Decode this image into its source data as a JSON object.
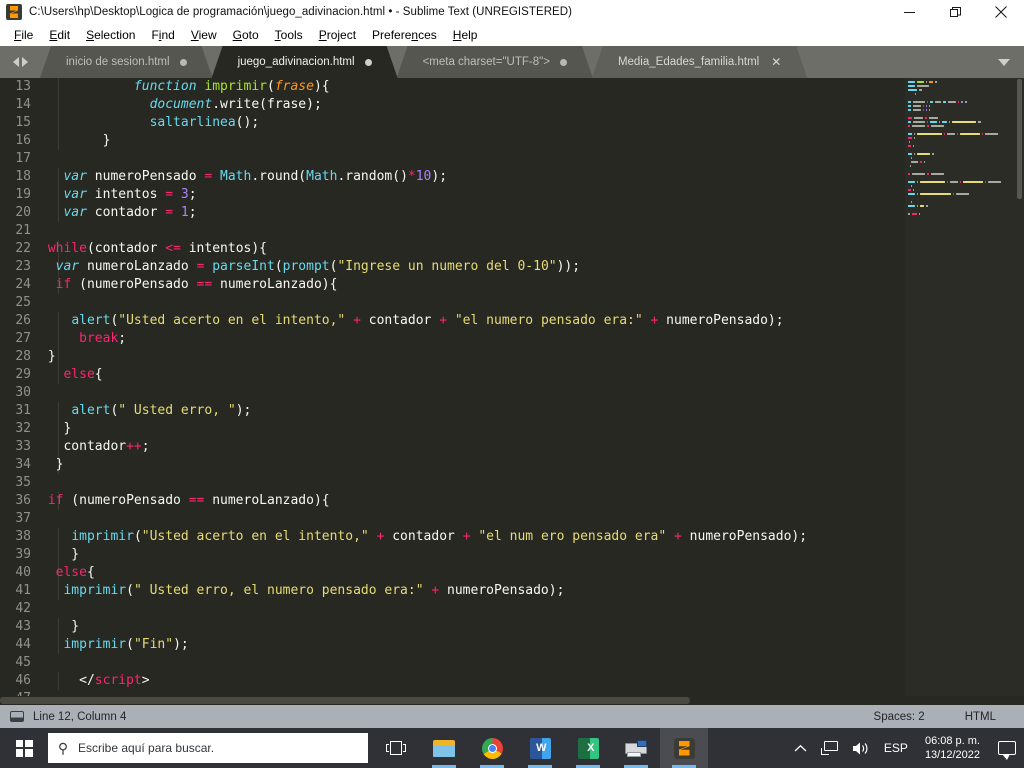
{
  "window": {
    "title": "C:\\Users\\hp\\Desktop\\Logica de programación\\juego_adivinacion.html • - Sublime Text (UNREGISTERED)",
    "app_icon": "sublime-text-icon",
    "controls": {
      "minimize": "minimize-icon",
      "maximize": "maximize-icon",
      "close": "close-icon"
    }
  },
  "menubar": {
    "items": [
      {
        "label": "File",
        "mnemonic": "F"
      },
      {
        "label": "Edit",
        "mnemonic": "E"
      },
      {
        "label": "Selection",
        "mnemonic": "S"
      },
      {
        "label": "Find",
        "mnemonic": "i"
      },
      {
        "label": "View",
        "mnemonic": "V"
      },
      {
        "label": "Goto",
        "mnemonic": "G"
      },
      {
        "label": "Tools",
        "mnemonic": "T"
      },
      {
        "label": "Project",
        "mnemonic": "P"
      },
      {
        "label": "Preferences",
        "mnemonic": "n"
      },
      {
        "label": "Help",
        "mnemonic": "H"
      }
    ]
  },
  "tabbar": {
    "nav_back_icon": "arrow-left-icon",
    "nav_forward_icon": "arrow-right-icon",
    "overflow_icon": "chevron-down-icon",
    "tabs": [
      {
        "label": "inicio de sesion.html",
        "state": "inactive",
        "dirty": true,
        "close": false
      },
      {
        "label": "juego_adivinacion.html",
        "state": "active",
        "dirty": true,
        "close": false
      },
      {
        "label": "<meta charset=\"UTF-8\">",
        "state": "inactive",
        "dirty": true,
        "close": false
      },
      {
        "label": "Media_Edades_familia.html",
        "state": "hover",
        "dirty": false,
        "close": true
      }
    ]
  },
  "editor": {
    "first_line": 13,
    "lines": [
      {
        "num": 13,
        "tokens": [
          {
            "t": "            ",
            "c": "p"
          },
          {
            "t": "function",
            "c": "it"
          },
          {
            "t": " ",
            "c": "p"
          },
          {
            "t": "imprimir",
            "c": "fn"
          },
          {
            "t": "(",
            "c": "p"
          },
          {
            "t": "frase",
            "c": "pa"
          },
          {
            "t": "){",
            "c": "p"
          }
        ]
      },
      {
        "num": 14,
        "tokens": [
          {
            "t": "              ",
            "c": "p"
          },
          {
            "t": "document",
            "c": "it"
          },
          {
            "t": ".write(frase);",
            "c": "p"
          }
        ]
      },
      {
        "num": 15,
        "tokens": [
          {
            "t": "              ",
            "c": "p"
          },
          {
            "t": "saltarlinea",
            "c": "f"
          },
          {
            "t": "();",
            "c": "p"
          }
        ]
      },
      {
        "num": 16,
        "tokens": [
          {
            "t": "        }",
            "c": "p"
          }
        ]
      },
      {
        "num": 17,
        "tokens": []
      },
      {
        "num": 18,
        "tokens": [
          {
            "t": "   ",
            "c": "p"
          },
          {
            "t": "var",
            "c": "it"
          },
          {
            "t": " numeroPensado ",
            "c": "p"
          },
          {
            "t": "=",
            "c": "k"
          },
          {
            "t": " ",
            "c": "p"
          },
          {
            "t": "Math",
            "c": "f"
          },
          {
            "t": ".round(",
            "c": "p"
          },
          {
            "t": "Math",
            "c": "f"
          },
          {
            "t": ".random()",
            "c": "p"
          },
          {
            "t": "*",
            "c": "k"
          },
          {
            "t": "10",
            "c": "n"
          },
          {
            "t": ");",
            "c": "p"
          }
        ]
      },
      {
        "num": 19,
        "tokens": [
          {
            "t": "   ",
            "c": "p"
          },
          {
            "t": "var",
            "c": "it"
          },
          {
            "t": " intentos ",
            "c": "p"
          },
          {
            "t": "=",
            "c": "k"
          },
          {
            "t": " ",
            "c": "p"
          },
          {
            "t": "3",
            "c": "n"
          },
          {
            "t": ";",
            "c": "p"
          }
        ]
      },
      {
        "num": 20,
        "tokens": [
          {
            "t": "   ",
            "c": "p"
          },
          {
            "t": "var",
            "c": "it"
          },
          {
            "t": " contador ",
            "c": "p"
          },
          {
            "t": "=",
            "c": "k"
          },
          {
            "t": " ",
            "c": "p"
          },
          {
            "t": "1",
            "c": "n"
          },
          {
            "t": ";",
            "c": "p"
          }
        ]
      },
      {
        "num": 21,
        "tokens": []
      },
      {
        "num": 22,
        "tokens": [
          {
            "t": " ",
            "c": "p"
          },
          {
            "t": "while",
            "c": "k"
          },
          {
            "t": "(contador ",
            "c": "p"
          },
          {
            "t": "<=",
            "c": "k"
          },
          {
            "t": " intentos){",
            "c": "p"
          }
        ]
      },
      {
        "num": 23,
        "tokens": [
          {
            "t": "  ",
            "c": "p"
          },
          {
            "t": "var",
            "c": "it"
          },
          {
            "t": " numeroLanzado ",
            "c": "p"
          },
          {
            "t": "=",
            "c": "k"
          },
          {
            "t": " ",
            "c": "p"
          },
          {
            "t": "parseInt",
            "c": "f"
          },
          {
            "t": "(",
            "c": "p"
          },
          {
            "t": "prompt",
            "c": "f"
          },
          {
            "t": "(",
            "c": "p"
          },
          {
            "t": "\"Ingrese un numero del 0-10\"",
            "c": "s"
          },
          {
            "t": "));",
            "c": "p"
          }
        ]
      },
      {
        "num": 24,
        "tokens": [
          {
            "t": "  ",
            "c": "p"
          },
          {
            "t": "if",
            "c": "k"
          },
          {
            "t": " (numeroPensado ",
            "c": "p"
          },
          {
            "t": "==",
            "c": "k"
          },
          {
            "t": " numeroLanzado){",
            "c": "p"
          }
        ]
      },
      {
        "num": 25,
        "tokens": []
      },
      {
        "num": 26,
        "tokens": [
          {
            "t": "    ",
            "c": "p"
          },
          {
            "t": "alert",
            "c": "f"
          },
          {
            "t": "(",
            "c": "p"
          },
          {
            "t": "\"Usted acerto en el intento,\"",
            "c": "s"
          },
          {
            "t": " ",
            "c": "p"
          },
          {
            "t": "+",
            "c": "k"
          },
          {
            "t": " contador ",
            "c": "p"
          },
          {
            "t": "+",
            "c": "k"
          },
          {
            "t": " ",
            "c": "p"
          },
          {
            "t": "\"el numero pensado era:\"",
            "c": "s"
          },
          {
            "t": " ",
            "c": "p"
          },
          {
            "t": "+",
            "c": "k"
          },
          {
            "t": " numeroPensado);",
            "c": "p"
          }
        ]
      },
      {
        "num": 27,
        "tokens": [
          {
            "t": "     ",
            "c": "p"
          },
          {
            "t": "break",
            "c": "k"
          },
          {
            "t": ";",
            "c": "p"
          }
        ]
      },
      {
        "num": 28,
        "tokens": [
          {
            "t": " }",
            "c": "p"
          }
        ]
      },
      {
        "num": 29,
        "tokens": [
          {
            "t": "   ",
            "c": "p"
          },
          {
            "t": "else",
            "c": "k"
          },
          {
            "t": "{",
            "c": "p"
          }
        ]
      },
      {
        "num": 30,
        "tokens": []
      },
      {
        "num": 31,
        "tokens": [
          {
            "t": "    ",
            "c": "p"
          },
          {
            "t": "alert",
            "c": "f"
          },
          {
            "t": "(",
            "c": "p"
          },
          {
            "t": "\" Usted erro, \"",
            "c": "s"
          },
          {
            "t": ");",
            "c": "p"
          }
        ]
      },
      {
        "num": 32,
        "tokens": [
          {
            "t": "   }",
            "c": "p"
          }
        ]
      },
      {
        "num": 33,
        "tokens": [
          {
            "t": "   contador",
            "c": "p"
          },
          {
            "t": "++",
            "c": "k"
          },
          {
            "t": ";",
            "c": "p"
          }
        ]
      },
      {
        "num": 34,
        "tokens": [
          {
            "t": "  }",
            "c": "p"
          }
        ]
      },
      {
        "num": 35,
        "tokens": []
      },
      {
        "num": 36,
        "tokens": [
          {
            "t": " ",
            "c": "p"
          },
          {
            "t": "if",
            "c": "k"
          },
          {
            "t": " (numeroPensado ",
            "c": "p"
          },
          {
            "t": "==",
            "c": "k"
          },
          {
            "t": " numeroLanzado){",
            "c": "p"
          }
        ]
      },
      {
        "num": 37,
        "tokens": []
      },
      {
        "num": 38,
        "tokens": [
          {
            "t": "    ",
            "c": "p"
          },
          {
            "t": "imprimir",
            "c": "f"
          },
          {
            "t": "(",
            "c": "p"
          },
          {
            "t": "\"Usted acerto en el intento,\"",
            "c": "s"
          },
          {
            "t": " ",
            "c": "p"
          },
          {
            "t": "+",
            "c": "k"
          },
          {
            "t": " contador ",
            "c": "p"
          },
          {
            "t": "+",
            "c": "k"
          },
          {
            "t": " ",
            "c": "p"
          },
          {
            "t": "\"el num ero pensado era\"",
            "c": "s"
          },
          {
            "t": " ",
            "c": "p"
          },
          {
            "t": "+",
            "c": "k"
          },
          {
            "t": " numeroPensado);",
            "c": "p"
          }
        ]
      },
      {
        "num": 39,
        "tokens": [
          {
            "t": "    }",
            "c": "p"
          }
        ]
      },
      {
        "num": 40,
        "tokens": [
          {
            "t": "  ",
            "c": "p"
          },
          {
            "t": "else",
            "c": "k"
          },
          {
            "t": "{",
            "c": "p"
          }
        ]
      },
      {
        "num": 41,
        "tokens": [
          {
            "t": "   ",
            "c": "p"
          },
          {
            "t": "imprimir",
            "c": "f"
          },
          {
            "t": "(",
            "c": "p"
          },
          {
            "t": "\" Usted erro, el numero pensado era:\"",
            "c": "s"
          },
          {
            "t": " ",
            "c": "p"
          },
          {
            "t": "+",
            "c": "k"
          },
          {
            "t": " numeroPensado);",
            "c": "p"
          }
        ]
      },
      {
        "num": 42,
        "tokens": []
      },
      {
        "num": 43,
        "tokens": [
          {
            "t": "    }",
            "c": "p"
          }
        ]
      },
      {
        "num": 44,
        "tokens": [
          {
            "t": "   ",
            "c": "p"
          },
          {
            "t": "imprimir",
            "c": "f"
          },
          {
            "t": "(",
            "c": "p"
          },
          {
            "t": "\"Fin\"",
            "c": "s"
          },
          {
            "t": ");",
            "c": "p"
          }
        ]
      },
      {
        "num": 45,
        "tokens": []
      },
      {
        "num": 46,
        "tokens": [
          {
            "t": "     ",
            "c": "p"
          },
          {
            "t": "</",
            "c": "p"
          },
          {
            "t": "script",
            "c": "k"
          },
          {
            "t": ">",
            "c": "p"
          }
        ]
      },
      {
        "num": 47,
        "tokens": []
      }
    ]
  },
  "statusbar": {
    "indicator_icon": "panel-icon",
    "cursor": "Line 12, Column 4",
    "indent": "Spaces: 2",
    "syntax": "HTML"
  },
  "taskbar": {
    "start_icon": "windows-start-icon",
    "search": {
      "icon": "search-icon",
      "placeholder": "Escribe aquí para buscar."
    },
    "buttons": [
      {
        "name": "task-view-icon",
        "label": "Task View",
        "active": false,
        "running": false
      },
      {
        "name": "file-explorer-icon",
        "label": "Explorador de archivos",
        "active": false,
        "running": true
      },
      {
        "name": "google-chrome-icon",
        "label": "Google Chrome",
        "active": false,
        "running": true
      },
      {
        "name": "microsoft-word-icon",
        "label": "Word",
        "active": false,
        "running": true,
        "glyph": "W"
      },
      {
        "name": "microsoft-excel-icon",
        "label": "Excel",
        "active": false,
        "running": true,
        "glyph": "X"
      },
      {
        "name": "printer-icon",
        "label": "Impresora",
        "active": false,
        "running": true
      },
      {
        "name": "sublime-text-icon",
        "label": "Sublime Text",
        "active": true,
        "running": true
      }
    ],
    "tray": {
      "overflow_icon": "chevron-up-icon",
      "network_icon": "network-icon",
      "volume_icon": "volume-icon",
      "language": "ESP",
      "time": "06:08 p. m.",
      "date": "13/12/2022",
      "action_center_icon": "action-center-icon"
    }
  },
  "colors": {
    "editor_bg": "#272822",
    "titlebar_bg": "#ffffff",
    "tabbar_bg": "#6e6e68",
    "statusbar_bg": "#aab0b6",
    "taskbar_bg": "#2f3136",
    "accent_orange": "#ff9800",
    "token_keyword": "#f92672",
    "token_string": "#e6db74",
    "token_function": "#66d9ef",
    "token_number": "#ae81ff",
    "token_plain": "#f8f8f2",
    "token_param": "#fd971f",
    "token_fnname": "#a6e22e"
  }
}
